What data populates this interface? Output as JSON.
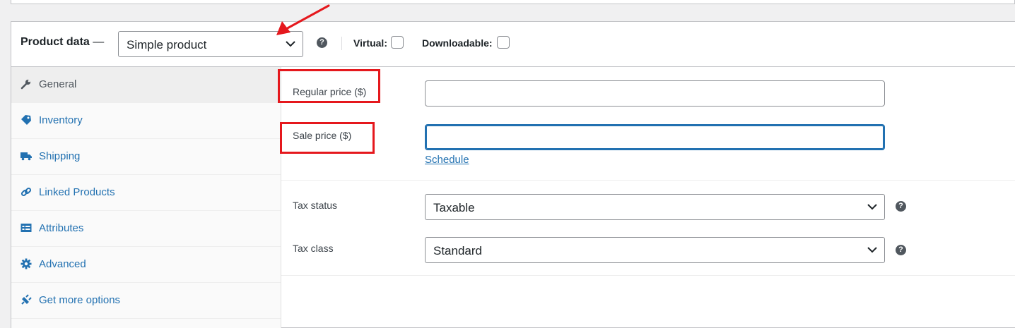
{
  "header": {
    "title": "Product data",
    "dash": "—",
    "product_type": "Simple product",
    "virtual_label": "Virtual:",
    "downloadable_label": "Downloadable:",
    "help_glyph": "?"
  },
  "tabs": [
    {
      "label": "General",
      "icon": "wrench-icon",
      "active": true
    },
    {
      "label": "Inventory",
      "icon": "tag-icon",
      "active": false
    },
    {
      "label": "Shipping",
      "icon": "truck-icon",
      "active": false
    },
    {
      "label": "Linked Products",
      "icon": "link-icon",
      "active": false
    },
    {
      "label": "Attributes",
      "icon": "list-card-icon",
      "active": false
    },
    {
      "label": "Advanced",
      "icon": "gear-icon",
      "active": false
    },
    {
      "label": "Get more options",
      "icon": "plugin-icon",
      "active": false
    }
  ],
  "general": {
    "regular_price_label": "Regular price ($)",
    "regular_price_value": "",
    "sale_price_label": "Sale price ($)",
    "sale_price_value": "",
    "schedule_link": "Schedule",
    "tax_status_label": "Tax status",
    "tax_status_value": "Taxable",
    "tax_class_label": "Tax class",
    "tax_class_value": "Standard"
  },
  "colors": {
    "accent": "#2271b1",
    "annotation": "#e5181d",
    "text": "#1d2327"
  }
}
